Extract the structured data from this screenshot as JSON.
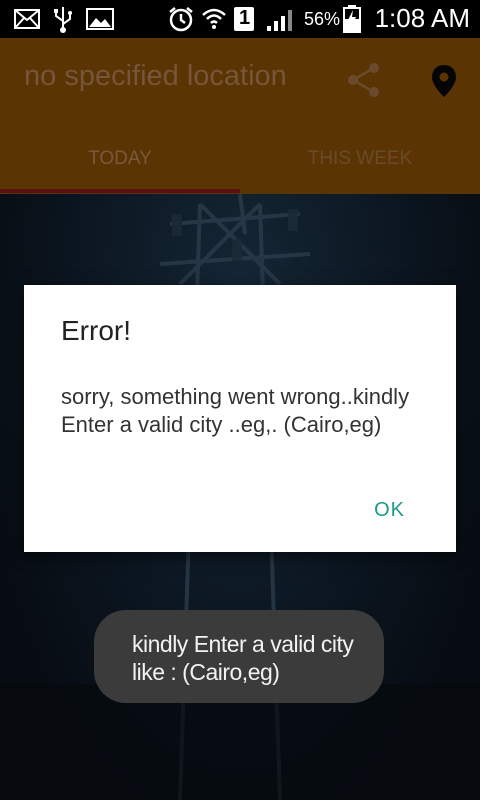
{
  "status_bar": {
    "time": "1:08 AM",
    "battery_percent": "56%",
    "sim_slot": "1",
    "icons": [
      "mail-icon",
      "usb-icon",
      "image-icon",
      "alarm-icon",
      "wifi-icon",
      "sim-icon",
      "signal-icon",
      "battery-icon"
    ]
  },
  "app_bar": {
    "title": "no specified location",
    "actions": [
      "share-icon",
      "location-pin-icon"
    ],
    "tabs": [
      {
        "label": "TODAY",
        "selected": true
      },
      {
        "label": "THIS WEEK",
        "selected": false
      }
    ],
    "color": "#5a3503"
  },
  "dialog": {
    "title": "Error!",
    "message": "sorry, something went wrong..kindly Enter a valid city ..eg,. (Cairo,eg)",
    "ok_label": "OK",
    "accent": "#1b9a8a"
  },
  "toast": {
    "text": "kindly Enter a valid city like : (Cairo,eg)"
  }
}
